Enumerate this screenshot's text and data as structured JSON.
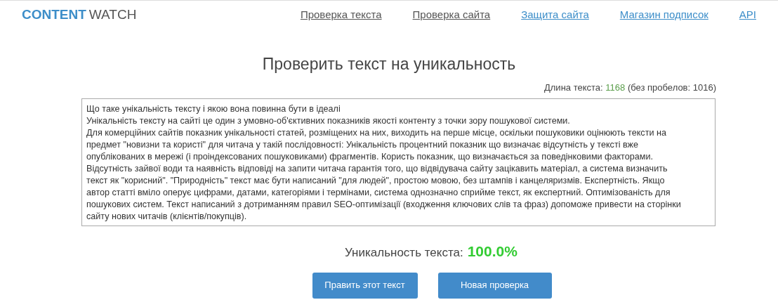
{
  "logo": {
    "part_1": "CONTENT",
    "part_2": "WATCH"
  },
  "nav": [
    {
      "label": "Проверка текста",
      "visited": true
    },
    {
      "label": "Проверка сайта",
      "visited": true
    },
    {
      "label": "Защита сайта",
      "visited": false
    },
    {
      "label": "Магазин подписок",
      "visited": false
    },
    {
      "label": "API",
      "visited": false
    }
  ],
  "title": "Проверить текст на уникальность",
  "length": {
    "label": "Длина текста:",
    "count": "1168",
    "without_spaces": "(без пробелов: 1016)"
  },
  "text_lines": [
    "Що таке унікальність тексту і якою вона повинна бути в ідеалі",
    "Унікальність тексту на сайті це один з умовно-об'єктивних показників якості контенту з точки зору пошукової системи.",
    "Для комерційних сайтів показник унікальності статей, розміщених на них, виходить на перше місце, оскільки пошуковики оцінюють тексти на",
    "предмет \"новизни та користі\" для читача у такій послідовності: Унікальність процентний показник що визначає відсутність у тексті вже",
    "опублікованих в мережі (і проіндексованих пошуковиками) фрагментів. Користь показник, що визначається за поведінковими факторами.",
    "Відсутність зайвої води та наявність відповіді на запити читача гарантія того, що відвідувача сайту зацікавить матеріал, а система визначить",
    "текст як \"корисний\". \"Природність\" текст має бути написаний \"для людей\", простою мовою, без штампів і канцеляризмів. Експертність. Якщо",
    "автор статті вміло оперує цифрами, датами, категоріями і термінами, система однозначно сприйме текст, як експертний. Оптимізованість для",
    "пошукових систем. Текст написаний з дотриманням правил SEO-оптимізації (входження ключових слів та фраз) допоможе привести на сторінки",
    "сайту нових читачів (клієнтів/покупців)."
  ],
  "uniqueness": {
    "label": "Уникальность текста:",
    "value": "100.0%"
  },
  "buttons": [
    "Править этот текст",
    "Новая проверка"
  ]
}
